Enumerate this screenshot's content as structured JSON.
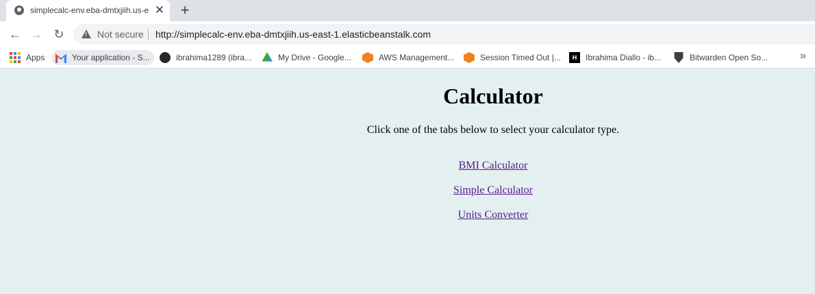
{
  "tab": {
    "title": "simplecalc-env.eba-dmtxjiih.us-e"
  },
  "toolbar": {
    "security_label": "Not secure",
    "url": "http://simplecalc-env.eba-dmtxjiih.us-east-1.elasticbeanstalk.com"
  },
  "bookmarks": [
    {
      "label": "Apps",
      "icon": "apps-icon"
    },
    {
      "label": "Your application - S...",
      "icon": "gmail-icon"
    },
    {
      "label": "ibrahima1289 (ibra...",
      "icon": "github-icon"
    },
    {
      "label": "My Drive - Google...",
      "icon": "google-drive-icon"
    },
    {
      "label": "AWS Management...",
      "icon": "aws-icon"
    },
    {
      "label": "Session Timed Out |...",
      "icon": "aws-icon"
    },
    {
      "label": "Ibrahima Diallo - ib...",
      "icon": "hashnode-icon"
    },
    {
      "label": "Bitwarden Open So...",
      "icon": "bitwarden-icon"
    }
  ],
  "page": {
    "heading": "Calculator",
    "intro": "Click one of the tabs below to select your calculator type.",
    "links": [
      "BMI Calculator",
      "Simple Calculator",
      "Units Converter"
    ]
  },
  "colors": {
    "page_background": "#e4f0f0",
    "link_visited": "#551a8b"
  }
}
